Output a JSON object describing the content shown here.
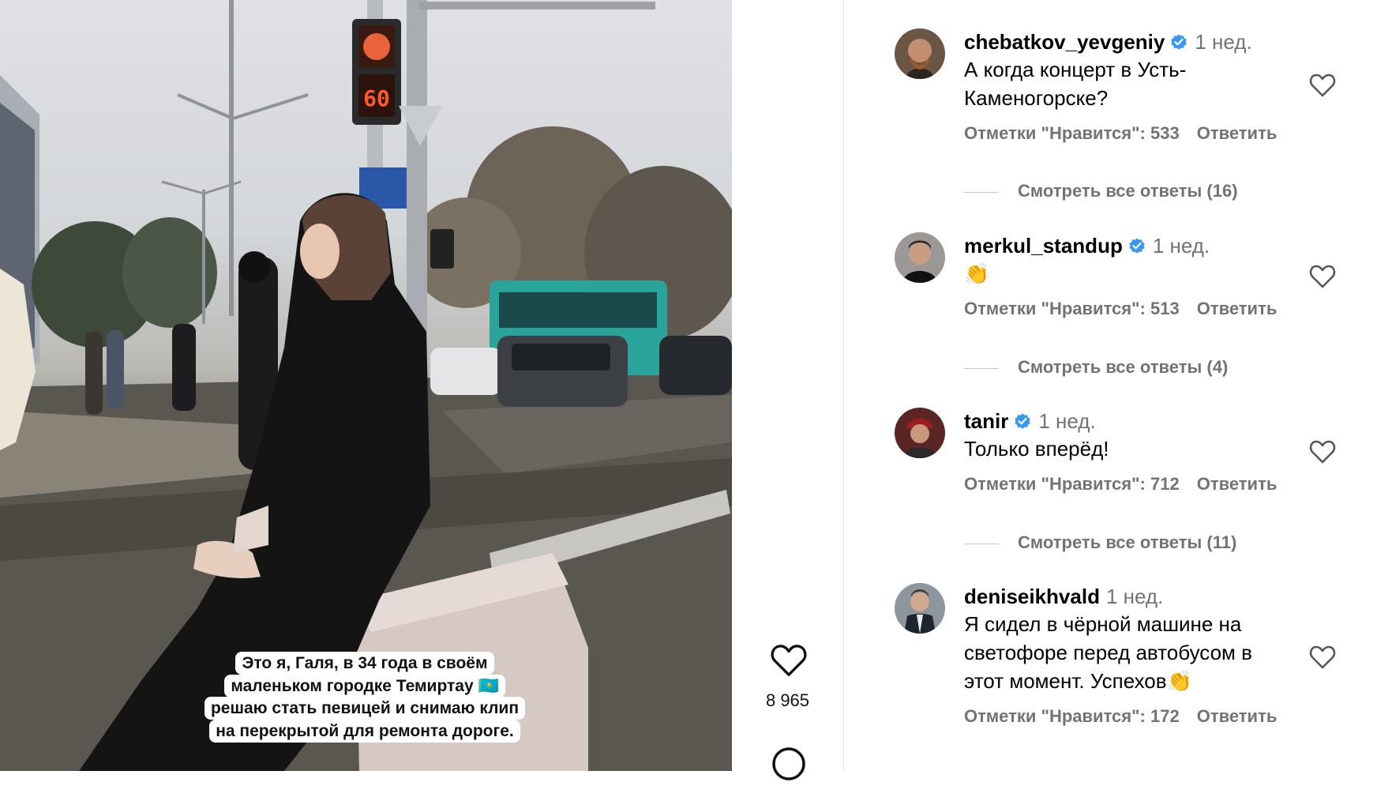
{
  "post": {
    "caption": "Это я, Галя, в 34 года в своём\nмаленьком городке Темиртау 🇰🇿\nрешаю стать певицей и снимаю клип\nна перекрытой для ремонта дороге.",
    "traffic_timer": "60",
    "likes": "8 965"
  },
  "icons": {
    "like": "heart-outline-icon",
    "comment": "speech-bubble-icon",
    "verified": "verified-badge-icon"
  },
  "colors": {
    "verified": "#3897f0",
    "meta_gray": "#737373"
  },
  "comments": [
    {
      "user": "chebatkov_yevgeniy",
      "verified": true,
      "time": "1 нед.",
      "text": "А когда концерт в Усть-\nКаменогорске?",
      "likes": "Отметки \"Нравится\": 533",
      "reply": "Ответить",
      "view_replies": "Смотреть все ответы (16)"
    },
    {
      "user": "merkul_standup",
      "verified": true,
      "time": "1 нед.",
      "text": "👏",
      "likes": "Отметки \"Нравится\": 513",
      "reply": "Ответить",
      "view_replies": "Смотреть все ответы (4)"
    },
    {
      "user": "tanir",
      "verified": true,
      "time": "1 нед.",
      "text": "Только вперёд!",
      "likes": "Отметки \"Нравится\": 712",
      "reply": "Ответить",
      "view_replies": "Смотреть все ответы (11)"
    },
    {
      "user": "deniseikhvald",
      "verified": false,
      "time": "1 нед.",
      "text": "Я сидел в чёрной машине на\nсветофоре перед автобусом в\nэтот момент. Успехов👏",
      "likes": "Отметки \"Нравится\": 172",
      "reply": "Ответить"
    }
  ]
}
